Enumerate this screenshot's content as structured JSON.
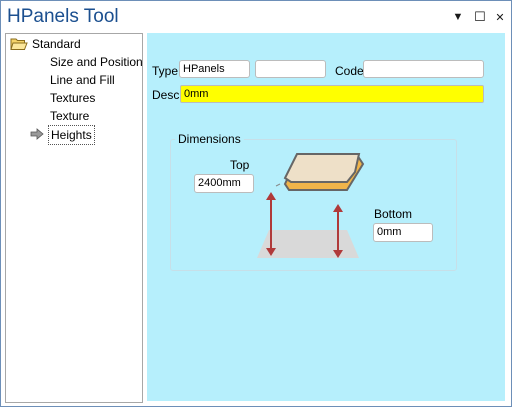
{
  "window": {
    "title": "HPanels Tool"
  },
  "titlebar": {
    "dropdown_glyph": "▼",
    "maximize_glyph": "☐",
    "close_glyph": "✕"
  },
  "tree": {
    "root_label": "Standard",
    "items": [
      {
        "label": "Size and Position"
      },
      {
        "label": "Line and Fill"
      },
      {
        "label": "Textures"
      },
      {
        "label": "Texture"
      },
      {
        "label": "Heights"
      }
    ]
  },
  "form": {
    "type_label": "Type:",
    "type_value": "HPanels",
    "type_extra_value": "",
    "code_label": "Code:",
    "code_value": "",
    "desc_label": "Desc:",
    "desc_value": "0mm"
  },
  "dimensions": {
    "title": "Dimensions",
    "top_label": "Top",
    "top_value": "2400mm",
    "bottom_label": "Bottom",
    "bottom_value": "0mm"
  },
  "colors": {
    "panel_bg": "#b6effc",
    "desc_bg": "#ffff00",
    "title_color": "#1b4f8f",
    "arrow_color": "#b03a3a",
    "slab_top": "#eee0c8",
    "slab_edge": "#f0b44a"
  }
}
